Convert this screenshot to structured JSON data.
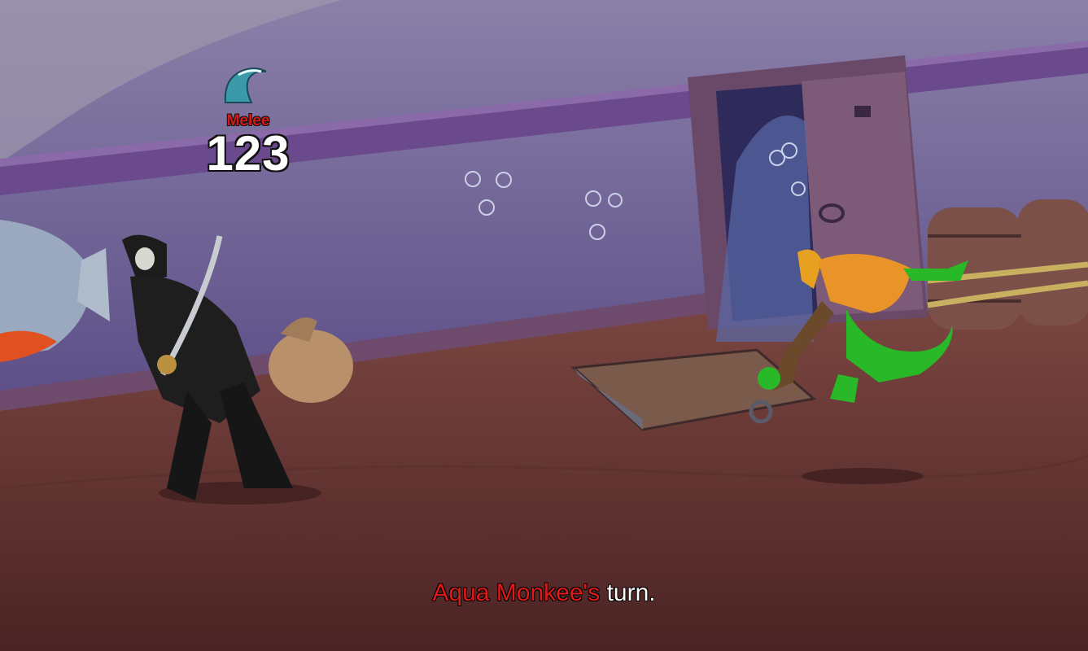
{
  "battle": {
    "damage_type": "Melee",
    "damage_value": "123",
    "damage_icon": "water-wave-icon",
    "turn_name": "Aqua Monkee's",
    "turn_suffix": " turn."
  },
  "colors": {
    "damage_label": "#d81818",
    "turn_name": "#e01818",
    "turn_text": "#ffffff",
    "floor": "#6b3a35",
    "wall": "#5b4d86"
  }
}
